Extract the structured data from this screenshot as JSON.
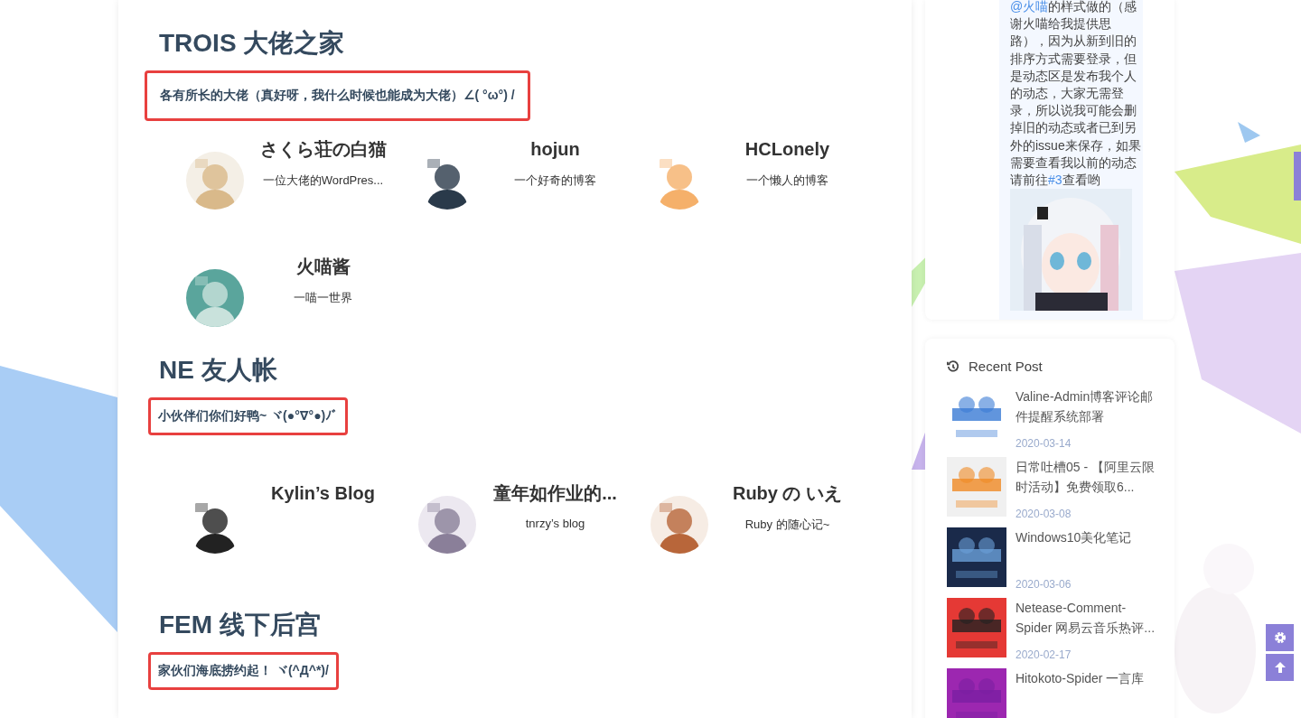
{
  "sections": [
    {
      "title": "TROIS 大佬之家",
      "subtitle": "各有所长的大佬（真好呀，我什么时候也能成为大佬）∠( °ω°) /",
      "friends": [
        {
          "name": "さくら荘の白猫",
          "description": "一位大佬的WordPres..."
        },
        {
          "name": "hojun",
          "description": "一个好奇的博客"
        },
        {
          "name": "HCLonely",
          "description": "一个懒人的博客"
        },
        {
          "name": "火喵酱",
          "description": "一喵一世界"
        }
      ]
    },
    {
      "title": "NE 友人帐",
      "subtitle": "小伙伴们你们好鸭~ ヾ(●°∇°●)ﾉﾞ",
      "friends": [
        {
          "name": "Kylin’s Blog"
        },
        {
          "name": "童年如作业的...",
          "description": "tnrzy’s blog"
        },
        {
          "name": "Ruby の いえ",
          "description": "Ruby 的随心记~"
        }
      ]
    },
    {
      "title": "FEM 线下后宫",
      "subtitle": "家伙们海底捞约起！ ヾ(^Д^*)/"
    }
  ],
  "notice": {
    "parts": [
      {
        "kind": "link",
        "text": "@火喵"
      },
      {
        "kind": "text",
        "text": "的样式做的（感谢火喵给我提供思路），因为从新到旧的排序方式需要登录，但是动态区是发布我个人的动态，大家无需登录，所以说我可能会删掉旧的动态或者已到另外的issue来保存，如果需要查看我以前的动态请前往"
      },
      {
        "kind": "link",
        "text": "#3"
      },
      {
        "kind": "text",
        "text": "查看哟"
      }
    ]
  },
  "recent_posts": {
    "title": "Recent Post",
    "posts": [
      {
        "title": "Valine-Admin博客评论邮件提醒系统部署",
        "date": "2020-03-14"
      },
      {
        "title": "日常吐槽05 - 【阿里云限时活动】免费领取6...",
        "date": "2020-03-08"
      },
      {
        "title": "Windows10美化笔记",
        "date": "2020-03-06"
      },
      {
        "title": "Netease-Comment-Spider 网易云音乐热评...",
        "date": "2020-02-17"
      },
      {
        "title": "Hitokoto-Spider 一言库"
      }
    ]
  }
}
